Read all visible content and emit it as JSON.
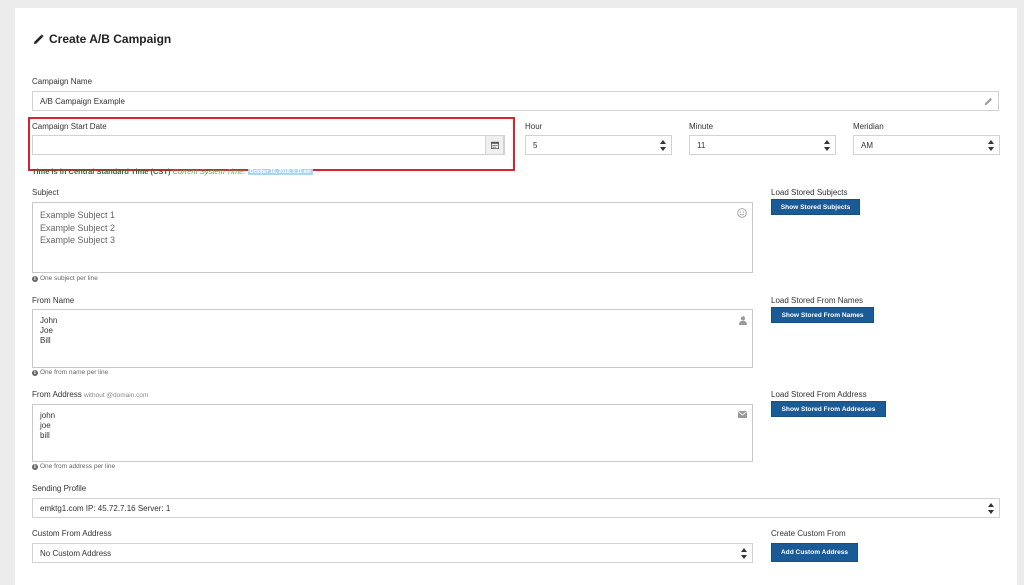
{
  "page": {
    "title": "Create A/B Campaign"
  },
  "campaign_name": {
    "label": "Campaign Name",
    "value": "A/B Campaign Example"
  },
  "start_date": {
    "label": "Campaign Start Date",
    "value": ""
  },
  "hour": {
    "label": "Hour",
    "value": "5"
  },
  "minute": {
    "label": "Minute",
    "value": "11"
  },
  "meridian": {
    "label": "Meridian",
    "value": "AM"
  },
  "timezone": {
    "note": "Time is in Central Standard Time (CST)",
    "system_time_label": "Current System Time:",
    "system_time_value": "October 16, 2018, 5:11 am"
  },
  "subject": {
    "label": "Subject",
    "lines": [
      "Example Subject 1",
      "Example Subject 2",
      "Example Subject 3"
    ],
    "help": "One subject per line",
    "load_label": "Load Stored Subjects",
    "load_button": "Show Stored Subjects"
  },
  "from_name": {
    "label": "From Name",
    "lines": [
      "John",
      "Joe",
      "Bill"
    ],
    "help": "One from name per line",
    "load_label": "Load Stored From Names",
    "load_button": "Show Stored From Names"
  },
  "from_address": {
    "label": "From Address",
    "sublabel": "without @domain.com",
    "lines": [
      "john",
      "joe",
      "bill"
    ],
    "help": "One from address per line",
    "load_label": "Load Stored From Address",
    "load_button": "Show Stored From Addresses"
  },
  "sending_profile": {
    "label": "Sending Profile",
    "value": "emktg1.com IP: 45.72.7.16 Server: 1"
  },
  "custom_from": {
    "label": "Custom From Address",
    "value": "No Custom Address",
    "create_label": "Create Custom From",
    "create_button": "Add Custom Address"
  },
  "icons": {
    "title": "pencil-icon",
    "campaign_name": "pencil-icon",
    "start_date": "calendar-icon",
    "subject": "smiley-icon",
    "from_name": "user-icon",
    "from_address": "envelope-icon",
    "help": "info-icon",
    "selects": "sort-icon"
  },
  "colors": {
    "button": "#1a5b97",
    "highlight_border": "#d9232d",
    "timezone_note": "#2e6b35",
    "system_time": "#4fa84a"
  }
}
